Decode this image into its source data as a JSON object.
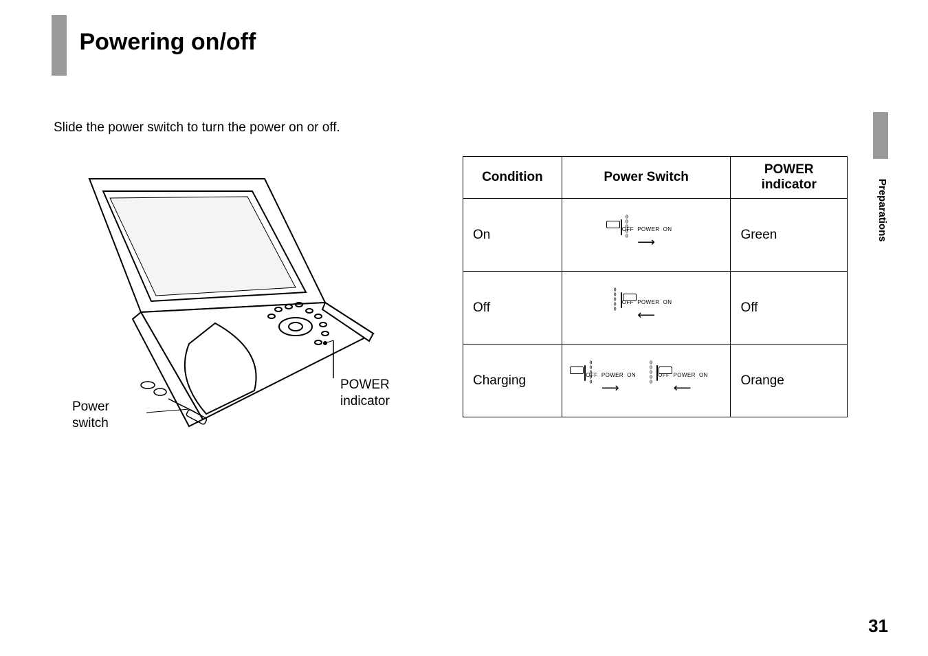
{
  "heading": "Powering on/off",
  "intro": "Slide the power switch to turn the power on or off.",
  "figure": {
    "callout_power_switch": "Power\nswitch",
    "callout_power_indicator": "POWER\nindicator"
  },
  "switch_labels": {
    "off": "OFF",
    "power": "POWER",
    "on": "ON"
  },
  "table": {
    "headers": {
      "condition": "Condition",
      "power_switch": "Power Switch",
      "power_indicator": "POWER indicator"
    },
    "rows": [
      {
        "condition": "On",
        "switch_dir": [
          "right"
        ],
        "indicator": "Green"
      },
      {
        "condition": "Off",
        "switch_dir": [
          "left"
        ],
        "indicator": "Off"
      },
      {
        "condition": "Charging",
        "switch_dir": [
          "right",
          "left"
        ],
        "indicator": "Orange"
      }
    ]
  },
  "side_section": "Preparations",
  "page_number": "31"
}
